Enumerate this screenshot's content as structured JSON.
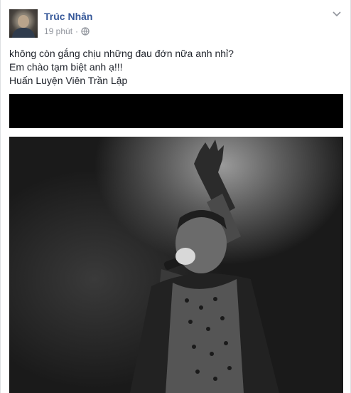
{
  "post": {
    "author": "Trúc Nhân",
    "time": "19 phút",
    "separator": "·",
    "privacy_icon": "globe-icon",
    "options_icon": "chevron-down-icon",
    "text_lines": [
      "không còn gắng chịu những đau đớn nữa anh nhỉ?",
      "Em chào tạm biệt anh ạ!!!",
      "Huấn Luyện Viên Trần Lập"
    ]
  },
  "colors": {
    "author_link": "#365899",
    "meta_text": "#90949c",
    "body_text": "#1d2129"
  }
}
